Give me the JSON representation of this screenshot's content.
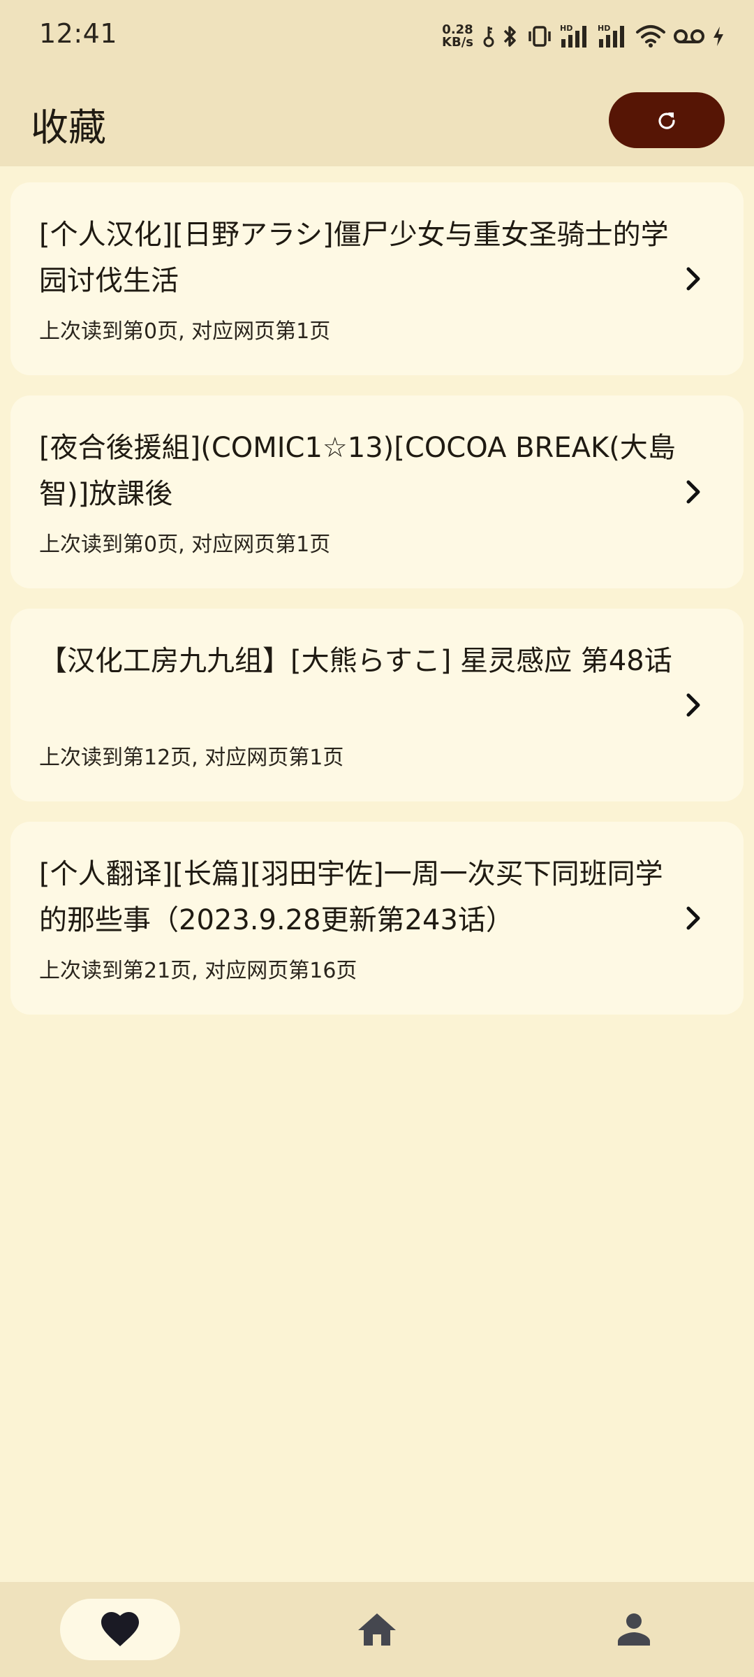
{
  "status_bar": {
    "time": "12:41",
    "net_speed_value": "0.28",
    "net_speed_unit": "KB/s",
    "icons": [
      "key-icon",
      "bluetooth-icon",
      "vibrate-icon",
      "signal-hd-icon",
      "signal-hd-icon",
      "wifi-icon",
      "voicemail-icon",
      "charging-icon"
    ]
  },
  "header": {
    "title": "收藏",
    "refresh_icon": "refresh-icon"
  },
  "favorites": [
    {
      "title": "[个人汉化][日野アラシ]僵尸少女与重女圣骑士的学园讨伐生活",
      "progress": "上次读到第0页, 对应网页第1页"
    },
    {
      "title": "[夜合後援組](COMIC1☆13)[COCOA BREAK(大島智)]放課後",
      "progress": "上次读到第0页, 对应网页第1页"
    },
    {
      "title": "【汉化工房九九组】[大熊らすこ] 星灵感应 第48话",
      "progress": "上次读到第12页, 对应网页第1页"
    },
    {
      "title": "[个人翻译][长篇][羽田宇佐]一周一次买下同班同学的那些事（2023.9.28更新第243话）",
      "progress": "上次读到第21页, 对应网页第16页"
    }
  ],
  "bottom_nav": {
    "items": [
      {
        "icon": "heart-icon",
        "active": true
      },
      {
        "icon": "home-icon",
        "active": false
      },
      {
        "icon": "person-icon",
        "active": false
      }
    ]
  },
  "colors": {
    "background": "#fbf3d4",
    "bar": "#efe2bd",
    "card": "#fef9e4",
    "accent": "#561505"
  }
}
